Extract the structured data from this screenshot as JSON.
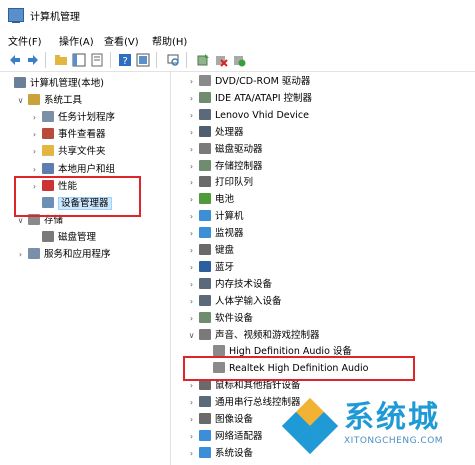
{
  "window": {
    "title": "计算机管理"
  },
  "menu": [
    "文件(F)",
    "操作(A)",
    "查看(V)",
    "帮助(H)"
  ],
  "left_tree": [
    {
      "label": "计算机管理(本地)",
      "chev": "",
      "indent": 0,
      "icon": "computer-icon",
      "color": "#6b7f99"
    },
    {
      "label": "系统工具",
      "chev": "∨",
      "indent": 1,
      "icon": "tools-icon",
      "color": "#c9a23a"
    },
    {
      "label": "任务计划程序",
      "chev": "›",
      "indent": 2,
      "icon": "clock-icon",
      "color": "#7a8fa8"
    },
    {
      "label": "事件查看器",
      "chev": "›",
      "indent": 2,
      "icon": "event-viewer-icon",
      "color": "#b94b3d"
    },
    {
      "label": "共享文件夹",
      "chev": "›",
      "indent": 2,
      "icon": "shared-folder-icon",
      "color": "#e2b640"
    },
    {
      "label": "本地用户和组",
      "chev": "›",
      "indent": 2,
      "icon": "users-icon",
      "color": "#5b7fb0"
    },
    {
      "label": "性能",
      "chev": "›",
      "indent": 2,
      "icon": "performance-icon",
      "color": "#cc3333"
    },
    {
      "label": "设备管理器",
      "chev": "",
      "indent": 2,
      "icon": "device-manager-icon",
      "color": "#6d8fb5",
      "selected": true
    },
    {
      "label": "存储",
      "chev": "∨",
      "indent": 1,
      "icon": "storage-icon",
      "color": "#8a8a8a"
    },
    {
      "label": "磁盘管理",
      "chev": "",
      "indent": 2,
      "icon": "disk-icon",
      "color": "#7a7a7a"
    },
    {
      "label": "服务和应用程序",
      "chev": "›",
      "indent": 1,
      "icon": "services-icon",
      "color": "#7a8fa8"
    }
  ],
  "device_tree": [
    {
      "label": "DVD/CD-ROM 驱动器",
      "chev": "›",
      "indent": 0,
      "icon": "dvd-icon",
      "color": "#8a8a8a"
    },
    {
      "label": "IDE ATA/ATAPI 控制器",
      "chev": "›",
      "indent": 0,
      "icon": "ide-controller-icon",
      "color": "#6f8c6f"
    },
    {
      "label": "Lenovo Vhid Device",
      "chev": "›",
      "indent": 0,
      "icon": "hid-icon",
      "color": "#5a6a7a"
    },
    {
      "label": "处理器",
      "chev": "›",
      "indent": 0,
      "icon": "processor-icon",
      "color": "#4f5f6f"
    },
    {
      "label": "磁盘驱动器",
      "chev": "›",
      "indent": 0,
      "icon": "disk-drive-icon",
      "color": "#7a7a7a"
    },
    {
      "label": "存储控制器",
      "chev": "›",
      "indent": 0,
      "icon": "storage-controller-icon",
      "color": "#6f8c6f"
    },
    {
      "label": "打印队列",
      "chev": "›",
      "indent": 0,
      "icon": "printer-icon",
      "color": "#6a6a6a"
    },
    {
      "label": "电池",
      "chev": "›",
      "indent": 0,
      "icon": "battery-icon",
      "color": "#4f9a3a"
    },
    {
      "label": "计算机",
      "chev": "›",
      "indent": 0,
      "icon": "computer-icon",
      "color": "#3c8fd6"
    },
    {
      "label": "监视器",
      "chev": "›",
      "indent": 0,
      "icon": "monitor-icon",
      "color": "#3c8fd6"
    },
    {
      "label": "键盘",
      "chev": "›",
      "indent": 0,
      "icon": "keyboard-icon",
      "color": "#6a6a6a"
    },
    {
      "label": "蓝牙",
      "chev": "›",
      "indent": 0,
      "icon": "bluetooth-icon",
      "color": "#2b5f9e"
    },
    {
      "label": "内存技术设备",
      "chev": "›",
      "indent": 0,
      "icon": "memory-icon",
      "color": "#5a6a7a"
    },
    {
      "label": "人体学输入设备",
      "chev": "›",
      "indent": 0,
      "icon": "hid-input-icon",
      "color": "#5a6a7a"
    },
    {
      "label": "软件设备",
      "chev": "›",
      "indent": 0,
      "icon": "software-device-icon",
      "color": "#6f8c6f"
    },
    {
      "label": "声音、视频和游戏控制器",
      "chev": "∨",
      "indent": 0,
      "icon": "sound-icon",
      "color": "#7a7a7a"
    },
    {
      "label": "High Definition Audio 设备",
      "chev": "",
      "indent": 1,
      "icon": "speaker-icon",
      "color": "#8a8a8a"
    },
    {
      "label": "Realtek High Definition Audio",
      "chev": "",
      "indent": 1,
      "icon": "speaker-icon",
      "color": "#8a8a8a"
    },
    {
      "label": "鼠标和其他指针设备",
      "chev": "›",
      "indent": 0,
      "icon": "mouse-icon",
      "color": "#6a6a6a"
    },
    {
      "label": "通用串行总线控制器",
      "chev": "›",
      "indent": 0,
      "icon": "usb-icon",
      "color": "#5a6a7a"
    },
    {
      "label": "图像设备",
      "chev": "›",
      "indent": 0,
      "icon": "camera-icon",
      "color": "#6a6a6a"
    },
    {
      "label": "网络适配器",
      "chev": "›",
      "indent": 0,
      "icon": "network-icon",
      "color": "#3c8fd6"
    },
    {
      "label": "系统设备",
      "chev": "›",
      "indent": 0,
      "icon": "system-device-icon",
      "color": "#3c8fd6"
    }
  ],
  "watermark": {
    "text": "系统城",
    "sub": "XITONGCHENG.COM"
  },
  "colors": {
    "highlight": "#e0242b",
    "watermark": "#1f9ad6"
  }
}
